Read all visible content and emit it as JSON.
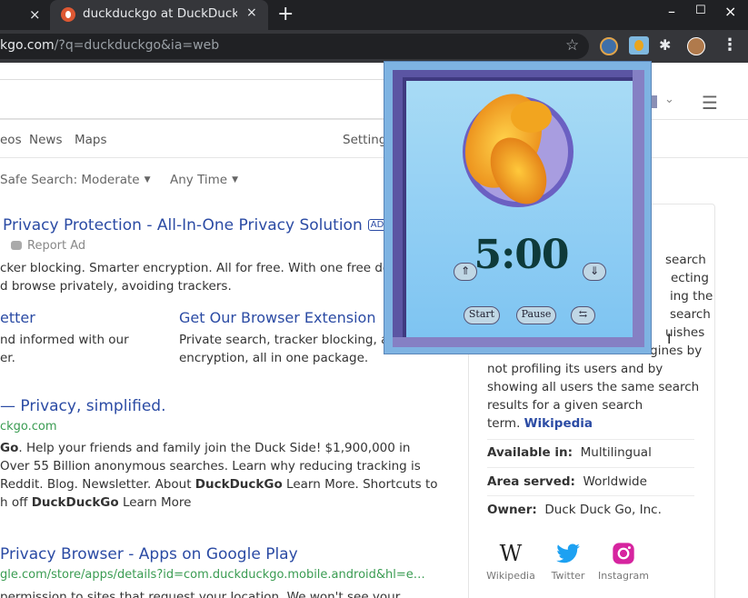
{
  "browser": {
    "prev_tab_close": "×",
    "active_tab": {
      "title": "duckduckgo at DuckDuckGo",
      "close": "×"
    },
    "new_tab": "+",
    "window": {
      "minimize": "–",
      "maximize": "☐",
      "close": "×"
    },
    "url_host": "kgo.com",
    "url_path": "/?q=duckduckgo&ia=web",
    "star": "☆",
    "extensions_icon": "puzzle-icon",
    "menu": "⋮"
  },
  "nav": {
    "videos": "eos",
    "news": "News",
    "maps": "Maps",
    "settings": "Settings",
    "hamburger": "☰",
    "chevron": "⌄"
  },
  "filters": {
    "safe_search": "Safe Search: Moderate",
    "time": "Any Time"
  },
  "results": {
    "ad": {
      "title": "Privacy Protection - All-In-One Privacy Solution",
      "badge": "AD",
      "report": "Report Ad",
      "line1": "cker blocking. Smarter encryption. All for free. With one free downlo",
      "line2": "d browse privately, avoiding trackers.",
      "sub1_title": "etter",
      "sub1_line1": "nd informed with our",
      "sub1_line2": "er.",
      "sub2_title": "Get Our Browser Extension",
      "sub2_line1": "Private search, tracker blocking, and",
      "sub2_line2": "encryption, all in one package."
    },
    "main": {
      "title": "— Privacy, simplified.",
      "url": "ckgo.com",
      "line1_bold": "Go",
      "line1": ". Help your friends and family join the Duck Side! $1,900,000 in",
      "line2": "Over 55 Billion anonymous searches. Learn why reducing tracking is",
      "line3_a": "Reddit. Blog. Newsletter. About ",
      "line3_bold": "DuckDuckGo",
      "line3_b": " Learn More. Shortcuts to",
      "line4_a": "h off ",
      "line4_bold": "DuckDuckGo",
      "line4_b": " Learn More"
    },
    "play": {
      "title": "Privacy Browser - Apps on Google Play",
      "url": "gle.com/store/apps/details?id=com.duckduckgo.mobile.android&hl=e…",
      "line1": "permission to sites that request your location. We won't see your"
    }
  },
  "infobox": {
    "lines": [
      "search",
      "ecting",
      "ing the",
      "search",
      "uishes",
      "itself from other search engines by",
      "not profiling its users and by",
      "showing all users the same search",
      "results for a given search"
    ],
    "last_line": "term.",
    "wiki_link": "Wikipedia",
    "available_label": "Available in:",
    "available_value": "Multilingual",
    "area_label": "Area served:",
    "area_value": "Worldwide",
    "owner_label": "Owner:",
    "owner_value": "Duck Duck Go, Inc.",
    "links": [
      {
        "label": "Wikipedia",
        "glyph": "W",
        "icon": "wikipedia-icon"
      },
      {
        "label": "Twitter",
        "icon": "twitter-icon"
      },
      {
        "label": "Instagram",
        "icon": "instagram-icon"
      }
    ]
  },
  "popup": {
    "image": "pisces-fish-icon",
    "time": "5:00",
    "up": "⇑",
    "down": "⇓",
    "start": "Start",
    "pause": "Pause",
    "swap": "⇆"
  },
  "colors": {
    "link": "#2b4ba4",
    "url_green": "#3a9c52",
    "popup_frame": "#5b55a3",
    "tab_bg": "#35363a"
  }
}
